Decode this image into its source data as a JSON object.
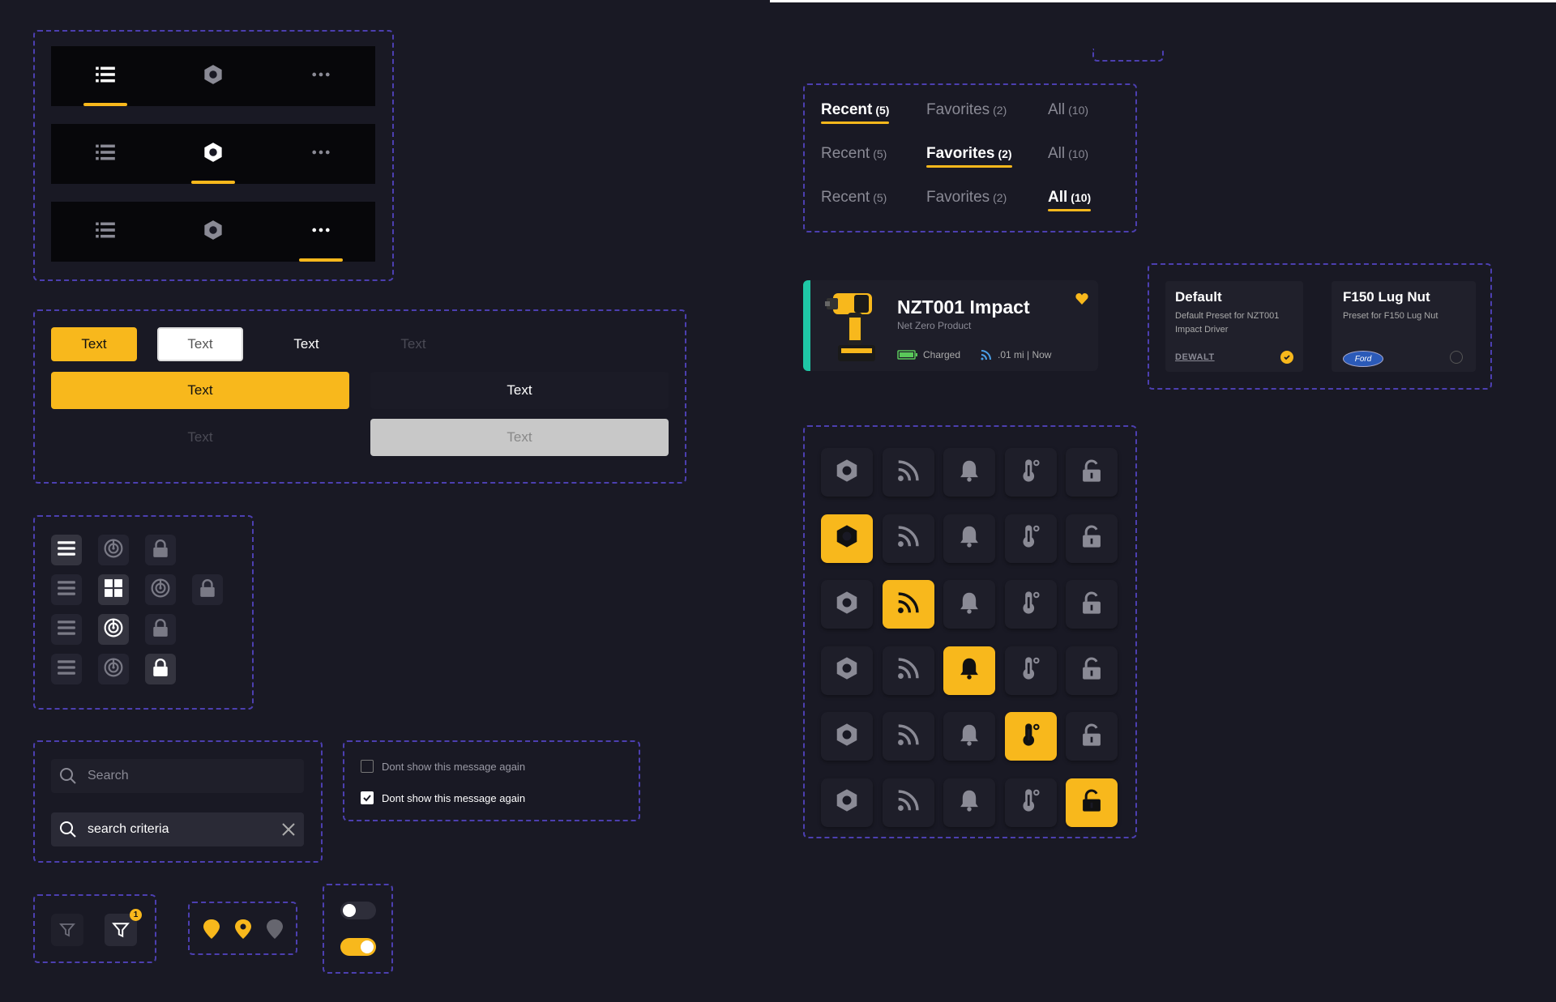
{
  "colors": {
    "accent": "#f8b81c",
    "teal": "#1fc7a6",
    "background": "#191924",
    "border": "#4c3fb0"
  },
  "tab_bars": [
    {
      "active": 0,
      "icons": [
        "list-icon",
        "hexagon-icon",
        "more-icon"
      ]
    },
    {
      "active": 1,
      "icons": [
        "list-icon",
        "hexagon-icon",
        "more-icon"
      ]
    },
    {
      "active": 2,
      "icons": [
        "list-icon",
        "hexagon-icon",
        "more-icon"
      ]
    }
  ],
  "buttons": {
    "primary_small": "Text",
    "secondary_small": "Text",
    "text_small": "Text",
    "disabled_small": "Text",
    "primary_wide": "Text",
    "dark_wide": "Text",
    "disabled_wide": "Text",
    "grey_wide": "Text"
  },
  "icon_grid": [
    "menu-icon",
    "grid-icon",
    "radar-icon",
    "lock-icon"
  ],
  "search": {
    "empty_placeholder": "Search",
    "filled_value": "search criteria"
  },
  "checkboxes": [
    {
      "label": "Dont show this message again",
      "checked": false
    },
    {
      "label": "Dont show this message again",
      "checked": true
    }
  ],
  "filter": {
    "badge": "1"
  },
  "filter_tabs": {
    "rows": [
      {
        "active": 0
      },
      {
        "active": 1
      },
      {
        "active": 2
      }
    ],
    "labels": [
      {
        "label": "Recent",
        "count": "(5)"
      },
      {
        "label": "Favorites",
        "count": "(2)"
      },
      {
        "label": "All",
        "count": "(10)"
      }
    ]
  },
  "tool_card": {
    "title": "NZT001 Impact",
    "subtitle": "Net Zero Product",
    "battery_status": "Charged",
    "location": ".01 mi | Now"
  },
  "presets": [
    {
      "title": "Default",
      "description": "Default Preset for NZT001 Impact Driver",
      "brand": "DEWALT",
      "selected": true
    },
    {
      "title": "F150 Lug Nut",
      "description": "Preset for F150 Lug Nut",
      "brand": "Ford",
      "selected": false
    }
  ],
  "icon_states": {
    "icons": [
      "hexagon-icon",
      "rss-icon",
      "bell-icon",
      "thermometer-icon",
      "unlock-icon"
    ],
    "active_per_row": [
      -1,
      0,
      1,
      2,
      3,
      4
    ]
  },
  "toggles": [
    {
      "on": false
    },
    {
      "on": true
    }
  ]
}
